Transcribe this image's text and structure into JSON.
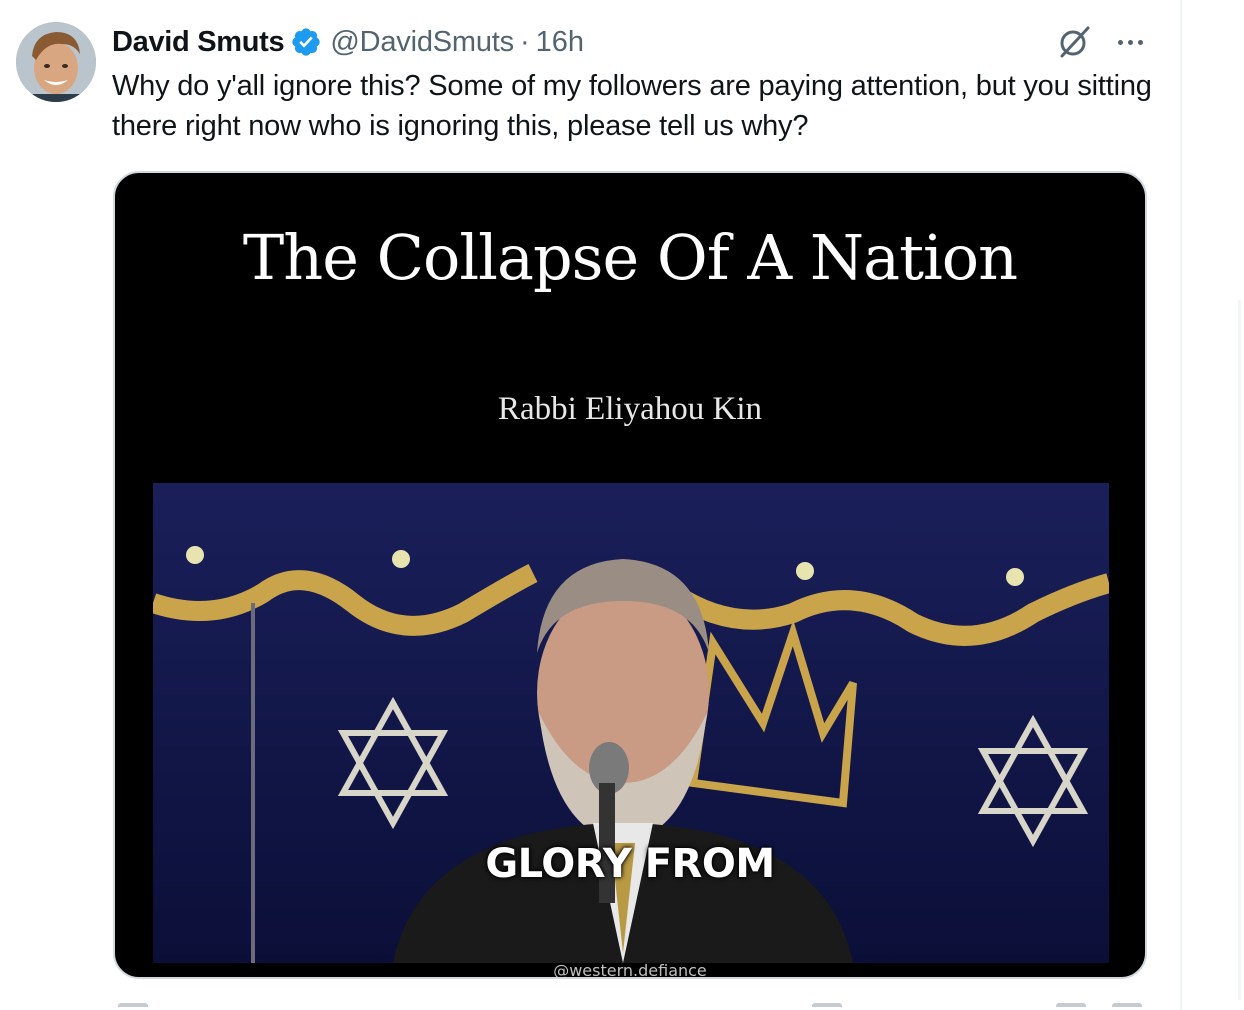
{
  "tweet": {
    "author_name": "David Smuts",
    "handle": "@DavidSmuts",
    "separator": "·",
    "time": "16h",
    "text": "Why do y'all ignore this? Some of my followers are paying attention, but you sitting there right now who is ignoring this, please tell us why?",
    "verified_color": "#1d9bf0"
  },
  "icons": {
    "avatar": "avatar",
    "verified": "verified-badge-icon",
    "grok": "grok-icon",
    "more": "more-icon"
  },
  "media": {
    "title": "The Collapse Of A Nation",
    "subtitle": "Rabbi Eliyahou Kin",
    "caption": "GLORY FROM",
    "watermark": "@western.defiance"
  }
}
